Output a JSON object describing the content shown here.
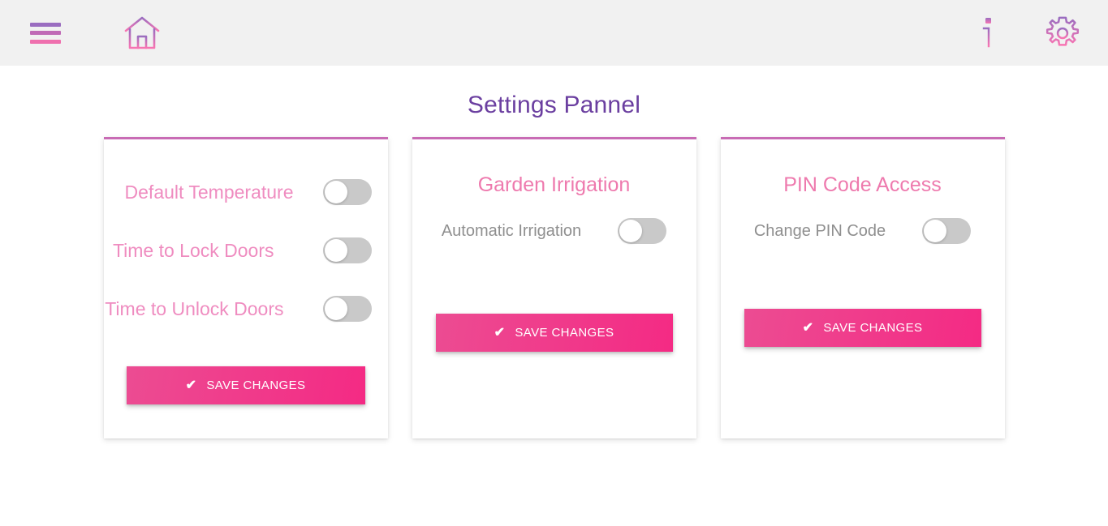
{
  "header": {
    "menu_icon": "hamburger-menu-icon",
    "home_icon": "home-icon",
    "info_icon": "info-icon",
    "settings_icon": "gear-icon"
  },
  "page": {
    "title": "Settings Pannel"
  },
  "colors": {
    "accent_purple": "#6b3fa0",
    "accent_pink": "#ee7aae",
    "card_top_border": "#c86bb4",
    "button_gradient_start": "#ec4c92",
    "button_gradient_end": "#f42a84",
    "toggle_off_track": "#c9c9c9",
    "header_background": "#f1f1f1"
  },
  "cards": [
    {
      "title": "",
      "rows": [
        {
          "label": "Default Temperature",
          "toggle_state": "off"
        },
        {
          "label": "Time to Lock Doors",
          "toggle_state": "off"
        },
        {
          "label": "Time to Unlock Doors",
          "toggle_state": "off"
        }
      ],
      "save_label": "SAVE CHANGES",
      "save_icon": "check-icon"
    },
    {
      "title": "Garden Irrigation",
      "rows": [
        {
          "label": "Automatic Irrigation",
          "toggle_state": "off"
        }
      ],
      "save_label": "SAVE CHANGES",
      "save_icon": "check-icon"
    },
    {
      "title": "PIN Code Access",
      "rows": [
        {
          "label": "Change PIN Code",
          "toggle_state": "off"
        }
      ],
      "save_label": "SAVE CHANGES",
      "save_icon": "check-icon"
    }
  ]
}
